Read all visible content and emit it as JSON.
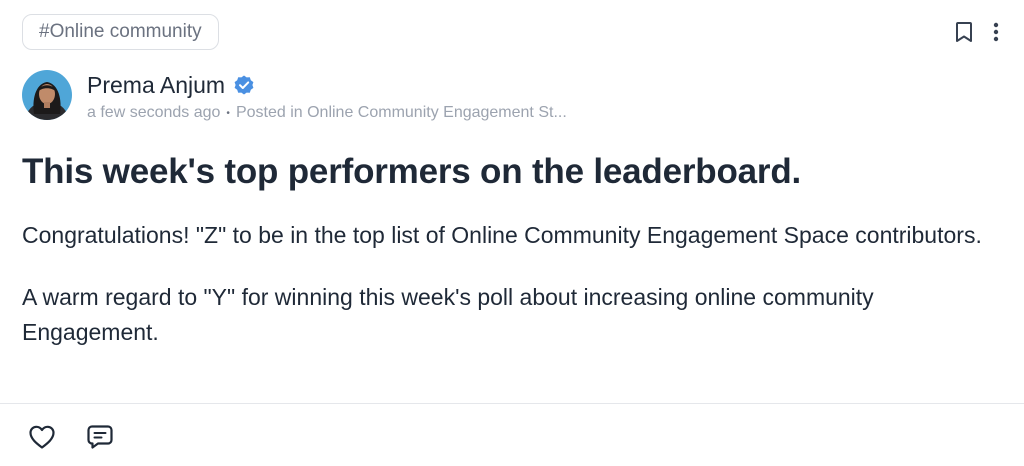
{
  "tag": {
    "label": "#Online community"
  },
  "author": {
    "name": "Prema Anjum",
    "verified": true,
    "timestamp": "a few seconds ago",
    "separator": "•",
    "posted_in": "Posted in Online Community Engagement St..."
  },
  "post": {
    "title": "This week's top performers on the leaderboard.",
    "paragraphs": [
      "Congratulations! \"Z\" to be in the top list of Online Community Engagement Space contributors.",
      "A warm regard to \"Y\" for winning this week's poll about increasing online community Engagement."
    ]
  },
  "icons": {
    "bookmark": "bookmark-icon",
    "more": "more-vertical-icon",
    "verified": "verified-badge-icon",
    "like": "heart-icon",
    "comment": "comment-icon"
  },
  "colors": {
    "text": "#1f2937",
    "muted": "#9ca3af",
    "verified": "#4a90e2",
    "border": "#dcdfe4"
  }
}
